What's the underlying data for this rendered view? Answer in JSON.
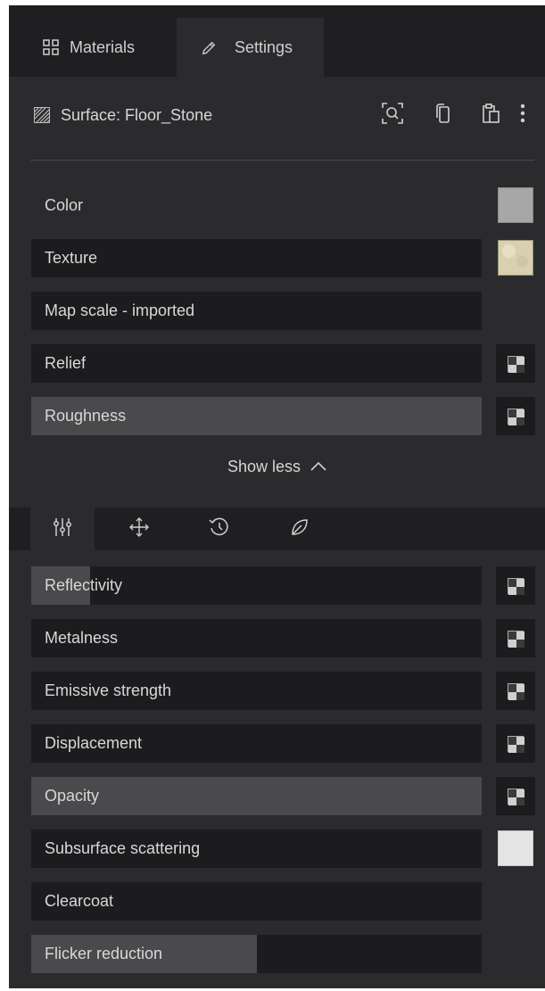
{
  "tabs": {
    "materials_label": "Materials",
    "settings_label": "Settings"
  },
  "header": {
    "surface_label": "Surface: Floor_Stone"
  },
  "properties": [
    {
      "label": "Color"
    },
    {
      "label": "Texture"
    },
    {
      "label": "Map scale - imported"
    },
    {
      "label": "Relief"
    },
    {
      "label": "Roughness",
      "value": 1.0
    }
  ],
  "show_less_label": "Show less",
  "advanced_properties": [
    {
      "label": "Reflectivity",
      "value": 0.13
    },
    {
      "label": "Metalness",
      "value": 0
    },
    {
      "label": "Emissive strength",
      "value": 0
    },
    {
      "label": "Displacement",
      "value": 0
    },
    {
      "label": "Opacity",
      "value": 1.0
    },
    {
      "label": "Subsurface scattering",
      "value": 0
    },
    {
      "label": "Clearcoat",
      "value": 0
    },
    {
      "label": "Flicker reduction",
      "value": 0.5
    }
  ],
  "colors": {
    "panel_bg": "#2b2b2e",
    "tabbar_bg": "#1f1f22",
    "row_bg": "#1c1c1f",
    "row_fill": "#4a4a4d",
    "color_swatch": "#a7a7a7",
    "sss_swatch": "#e4e4e4"
  }
}
